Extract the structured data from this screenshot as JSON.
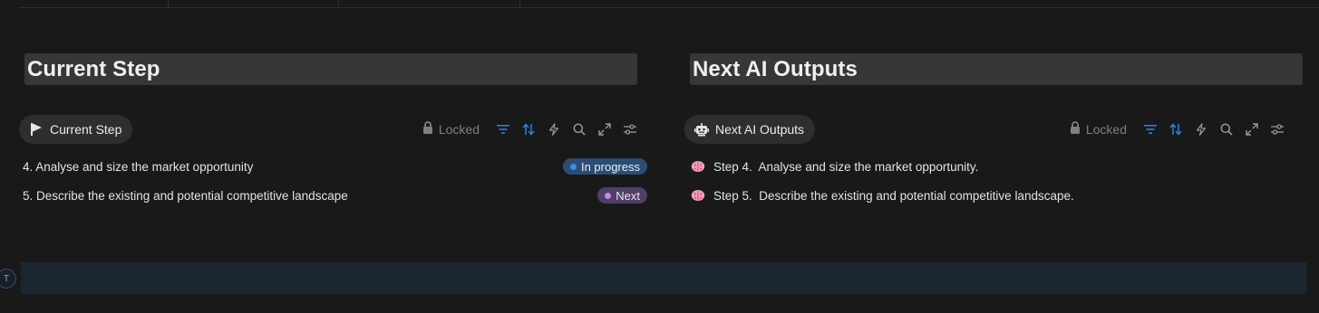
{
  "left_panel": {
    "heading": "Current Step",
    "view_tab": {
      "label": "Current Step",
      "icon": "flag-icon"
    },
    "toolbar": {
      "lock_label": "Locked"
    },
    "rows": [
      {
        "title": "4. Analyse and size the market opportunity",
        "status": "In progress"
      },
      {
        "title": "5. Describe the existing and potential competitive landscape",
        "status": "Next"
      }
    ]
  },
  "right_panel": {
    "heading": "Next AI Outputs",
    "view_tab": {
      "label": "Next AI Outputs",
      "icon": "robot-icon"
    },
    "toolbar": {
      "lock_label": "Locked"
    },
    "rows": [
      {
        "icon": "brain-icon",
        "text": "Step 4.  Analyse and size the market opportunity."
      },
      {
        "icon": "brain-icon",
        "text": "Step 5.  Describe the existing and potential competitive landscape."
      }
    ]
  },
  "comment": {
    "avatar_initial": "T"
  },
  "colors": {
    "background": "#191919",
    "accent_blue": "#2f7fe0",
    "status_in_progress": "#2c4d73",
    "status_next": "#503f66"
  }
}
